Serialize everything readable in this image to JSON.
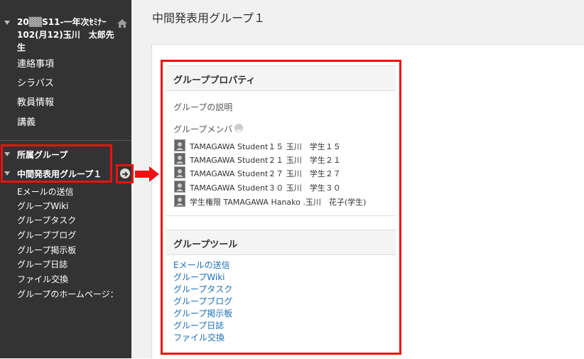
{
  "sidebar": {
    "course_title": "20▒▒S11-一年次ｾﾐﾅｰ102(月12)玉川　太郎先生",
    "menu": [
      "連絡事項",
      "シラバス",
      "教員情報",
      "講義"
    ],
    "groups_label": "所属グループ",
    "current_group": "中間発表用グループ１",
    "group_menu": [
      "Eメールの送信",
      "グループWiki",
      "グループタスク",
      "グループブログ",
      "グループ掲示板",
      "グループ日誌",
      "ファイル交換",
      "グループのホームページ："
    ]
  },
  "main": {
    "page_title": "中間発表用グループ１",
    "properties": {
      "header": "グループプロパティ",
      "description_label": "グループの説明",
      "members_label": "グループメンバ",
      "members": [
        "TAMAGAWA Student１５ 玉川　学生１５",
        "TAMAGAWA Student２１ 玉川　学生２１",
        "TAMAGAWA Student２７ 玉川　学生２７",
        "TAMAGAWA Student３０ 玉川　学生３０",
        "学生権限 TAMAGAWA Hanako .玉川　花子(学生)"
      ]
    },
    "tools": {
      "header": "グループツール",
      "links": [
        "Eメールの送信",
        "グループWiki",
        "グループタスク",
        "グループブログ",
        "グループ掲示板",
        "グループ日誌",
        "ファイル交換"
      ]
    }
  },
  "colors": {
    "sidebar_bg": "#333333",
    "highlight_red": "#ee1111",
    "link": "#1a6fb5"
  }
}
